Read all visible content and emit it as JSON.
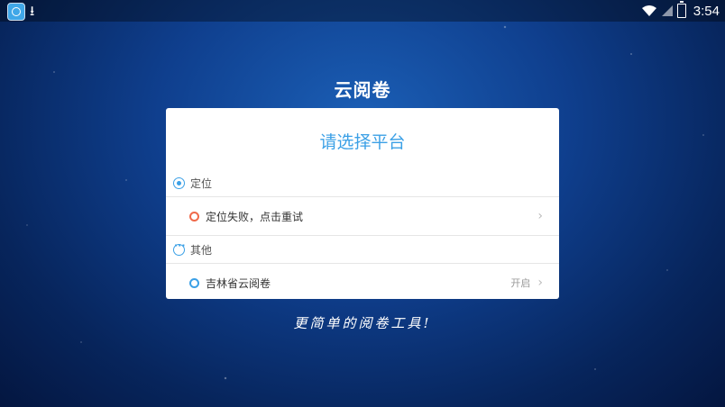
{
  "status_bar": {
    "left_icons": [
      "app-icon",
      "download-icon"
    ],
    "time": "3:54",
    "right_icons": [
      "wifi-icon",
      "signal-icon",
      "battery-charging-icon"
    ]
  },
  "app": {
    "title": "云阅卷",
    "slogan": "更简单的阅卷工具!"
  },
  "dialog": {
    "title": "请选择平台",
    "sections": [
      {
        "label": "定位",
        "icon": "location-target-icon",
        "items": [
          {
            "label": "定位失败，点击重试",
            "status": "",
            "dot_color": "#f06a4a"
          }
        ]
      },
      {
        "label": "其他",
        "icon": "more-dots-icon",
        "items": [
          {
            "label": "吉林省云阅卷",
            "status": "开启",
            "dot_color": "#3ba0e6"
          }
        ]
      }
    ]
  },
  "colors": {
    "accent": "#3ba0e6",
    "error": "#f06a4a",
    "background": "#0f3f8e"
  }
}
